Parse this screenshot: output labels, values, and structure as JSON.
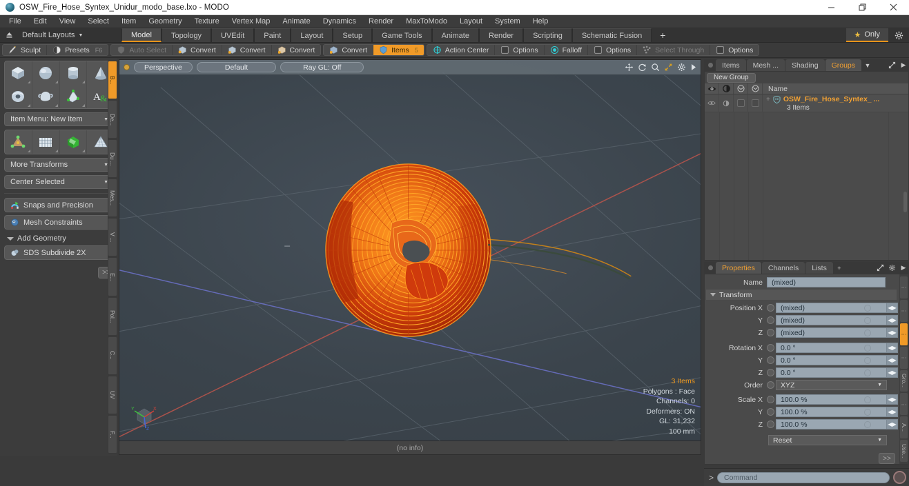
{
  "window": {
    "title": "OSW_Fire_Hose_Syntex_Unidur_modo_base.lxo - MODO",
    "app_icon": "modo-sphere-icon",
    "minimize": "minimize-icon",
    "maximize": "restore-icon",
    "close": "close-icon"
  },
  "menubar": {
    "items": [
      "File",
      "Edit",
      "View",
      "Select",
      "Item",
      "Geometry",
      "Texture",
      "Vertex Map",
      "Animate",
      "Dynamics",
      "Render",
      "MaxToModo",
      "Layout",
      "System",
      "Help"
    ]
  },
  "layoutbar": {
    "up_icon": "up-arrow-icon",
    "layouts_label": "Default Layouts",
    "tabs": [
      {
        "label": "Model",
        "active": true
      },
      {
        "label": "Topology",
        "active": false
      },
      {
        "label": "UVEdit",
        "active": false
      },
      {
        "label": "Paint",
        "active": false
      },
      {
        "label": "Layout",
        "active": false
      },
      {
        "label": "Setup",
        "active": false
      },
      {
        "label": "Game Tools",
        "active": false
      },
      {
        "label": "Animate",
        "active": false
      },
      {
        "label": "Render",
        "active": false
      },
      {
        "label": "Scripting",
        "active": false
      },
      {
        "label": "Schematic Fusion",
        "active": false
      }
    ],
    "plus": "+",
    "only_label": "Only",
    "star_icon": "star-icon",
    "gear_icon": "gear-icon"
  },
  "toolbar": {
    "groups": [
      {
        "buttons": [
          {
            "label": "Sculpt",
            "icon": "sculpt-brush-icon",
            "state": "normal",
            "hotkey": ""
          },
          {
            "label": "Presets",
            "icon": "presets-sphere-icon",
            "state": "normal",
            "hotkey": "F6"
          }
        ]
      },
      {
        "buttons": [
          {
            "label": "Auto Select",
            "icon": "shield-icon",
            "state": "dim",
            "hotkey": ""
          },
          {
            "label": "Convert",
            "icon": "convert-vertex-icon",
            "state": "normal",
            "hotkey": ""
          },
          {
            "label": "Convert",
            "icon": "convert-edge-icon",
            "state": "normal",
            "hotkey": ""
          },
          {
            "label": "Convert",
            "icon": "convert-polygon-icon",
            "state": "normal",
            "hotkey": ""
          }
        ]
      },
      {
        "buttons": [
          {
            "label": "Convert",
            "icon": "convert-material-icon",
            "state": "normal",
            "hotkey": ""
          },
          {
            "label": "Items",
            "icon": "items-icon",
            "state": "active",
            "hotkey": "5"
          }
        ]
      },
      {
        "buttons": [
          {
            "label": "Action Center",
            "icon": "action-center-icon",
            "state": "normal",
            "hotkey": ""
          },
          {
            "label": "Options",
            "icon": "checkbox-icon",
            "state": "normal",
            "hotkey": ""
          },
          {
            "label": "Falloff",
            "icon": "falloff-icon",
            "state": "normal",
            "hotkey": ""
          },
          {
            "label": "Options",
            "icon": "checkbox-icon",
            "state": "normal",
            "hotkey": ""
          },
          {
            "label": "Select Through",
            "icon": "select-through-icon",
            "state": "dim",
            "hotkey": ""
          },
          {
            "label": "Options",
            "icon": "checkbox-icon",
            "state": "normal",
            "hotkey": ""
          }
        ]
      }
    ]
  },
  "left_panel": {
    "primitive_rows": [
      [
        {
          "name": "cube-primitive-icon"
        },
        {
          "name": "sphere-primitive-icon"
        },
        {
          "name": "cylinder-primitive-icon"
        },
        {
          "name": "cone-primitive-icon"
        }
      ],
      [
        {
          "name": "torus-primitive-icon"
        },
        {
          "name": "teapot-primitive-icon"
        },
        {
          "name": "prism-mesh-icon"
        },
        {
          "name": "text-tool-icon"
        }
      ]
    ],
    "item_menu_label": "Item Menu: New Item",
    "transform_rows": [
      [
        {
          "name": "transform-gizmo-icon"
        },
        {
          "name": "bend-grid-icon"
        },
        {
          "name": "deform-green-icon"
        },
        {
          "name": "lattice-icon"
        }
      ]
    ],
    "more_transforms_label": "More Transforms",
    "center_selected_label": "Center Selected",
    "snaps_label": "Snaps and Precision",
    "snaps_icon": "magnet-snap-icon",
    "mesh_constraints_label": "Mesh Constraints",
    "mesh_constraints_icon": "constraints-icon",
    "add_geometry_label": "Add Geometry",
    "sds_label": "SDS Subdivide 2X",
    "sds_icon": "sds-sphere-icon",
    "more_button": ">>",
    "vtabs": [
      {
        "label": "B...",
        "active": true
      },
      {
        "label": "De...",
        "active": false
      },
      {
        "label": "Du ...",
        "active": false
      },
      {
        "label": "Mes...",
        "active": false
      },
      {
        "label": "V ...",
        "active": false
      },
      {
        "label": "E...",
        "active": false
      },
      {
        "label": "Pol...",
        "active": false
      },
      {
        "label": "C...",
        "active": false
      },
      {
        "label": "UV",
        "active": false
      },
      {
        "label": "F...",
        "active": false
      }
    ]
  },
  "viewport": {
    "projection": "Perspective",
    "shading": "Default",
    "raygl": "Ray GL: Off",
    "header_icons": [
      "move-icon",
      "rotate-icon",
      "zoom-icon",
      "fit-icon",
      "gear-icon",
      "chevron-right-icon"
    ],
    "info": {
      "items": "3 Items",
      "polygons": "Polygons : Face",
      "channels": "Channels: 0",
      "deformers": "Deformers: ON",
      "gl": "GL: 31,232",
      "scale": "100 mm"
    },
    "footer": "(no info)",
    "gizmo": {
      "x": "X",
      "y": "Y",
      "z": "Z"
    },
    "model_colors": {
      "wire_bright": "#ffa020",
      "wire_dark": "#c43008",
      "fill": "#e8601a"
    }
  },
  "right_panel": {
    "top": {
      "tabs": [
        {
          "label": "Items",
          "active": false
        },
        {
          "label": "Mesh ...",
          "active": false
        },
        {
          "label": "Shading",
          "active": false
        },
        {
          "label": "Groups",
          "active": true
        }
      ],
      "menu_icon": "chevron-down-icon",
      "expand_icon": "expand-icon",
      "arrow_icon": "chevron-right-icon",
      "new_group_label": "New Group",
      "columns": [
        "eye-icon",
        "render-icon",
        "wireframe-icon",
        "shaded-icon"
      ],
      "name_header": "Name",
      "rows": [
        {
          "label": "OSW_Fire_Hose_Syntex_ ...",
          "sub": "3 Items",
          "icon": "group-item-icon",
          "expand": "+"
        }
      ]
    },
    "properties": {
      "tabs": [
        {
          "label": "Properties",
          "active": true
        },
        {
          "label": "Channels",
          "active": false
        },
        {
          "label": "Lists",
          "active": false
        }
      ],
      "plus": "+",
      "expand_icon": "expand-icon",
      "gear_icon": "gear-icon",
      "arrow_icon": "chevron-right-icon",
      "name_label": "Name",
      "name_value": "(mixed)",
      "transform_label": "Transform",
      "fields": [
        {
          "label": "Position X",
          "value": "(mixed)"
        },
        {
          "label": "Y",
          "value": "(mixed)"
        },
        {
          "label": "Z",
          "value": "(mixed)"
        },
        {
          "label": "Rotation X",
          "value": "0.0 °"
        },
        {
          "label": "Y",
          "value": "0.0 °"
        },
        {
          "label": "Z",
          "value": "0.0 °"
        }
      ],
      "order_label": "Order",
      "order_value": "XYZ",
      "scale_fields": [
        {
          "label": "Scale X",
          "value": "100.0 %"
        },
        {
          "label": "Y",
          "value": "100.0 %"
        },
        {
          "label": "Z",
          "value": "100.0 %"
        }
      ],
      "reset_label": "Reset",
      "more_button": ">>",
      "vtabs": [
        {
          "label": "·",
          "active": false
        },
        {
          "label": "·",
          "active": false
        },
        {
          "label": "·",
          "active": true
        },
        {
          "label": "·",
          "active": false
        },
        {
          "label": "Gro...",
          "active": false
        },
        {
          "label": "·",
          "active": false
        },
        {
          "label": "A...",
          "active": false
        },
        {
          "label": "Use...",
          "active": false
        }
      ]
    }
  },
  "command_bar": {
    "prompt": ">",
    "placeholder": "Command",
    "record_icon": "record-icon"
  }
}
